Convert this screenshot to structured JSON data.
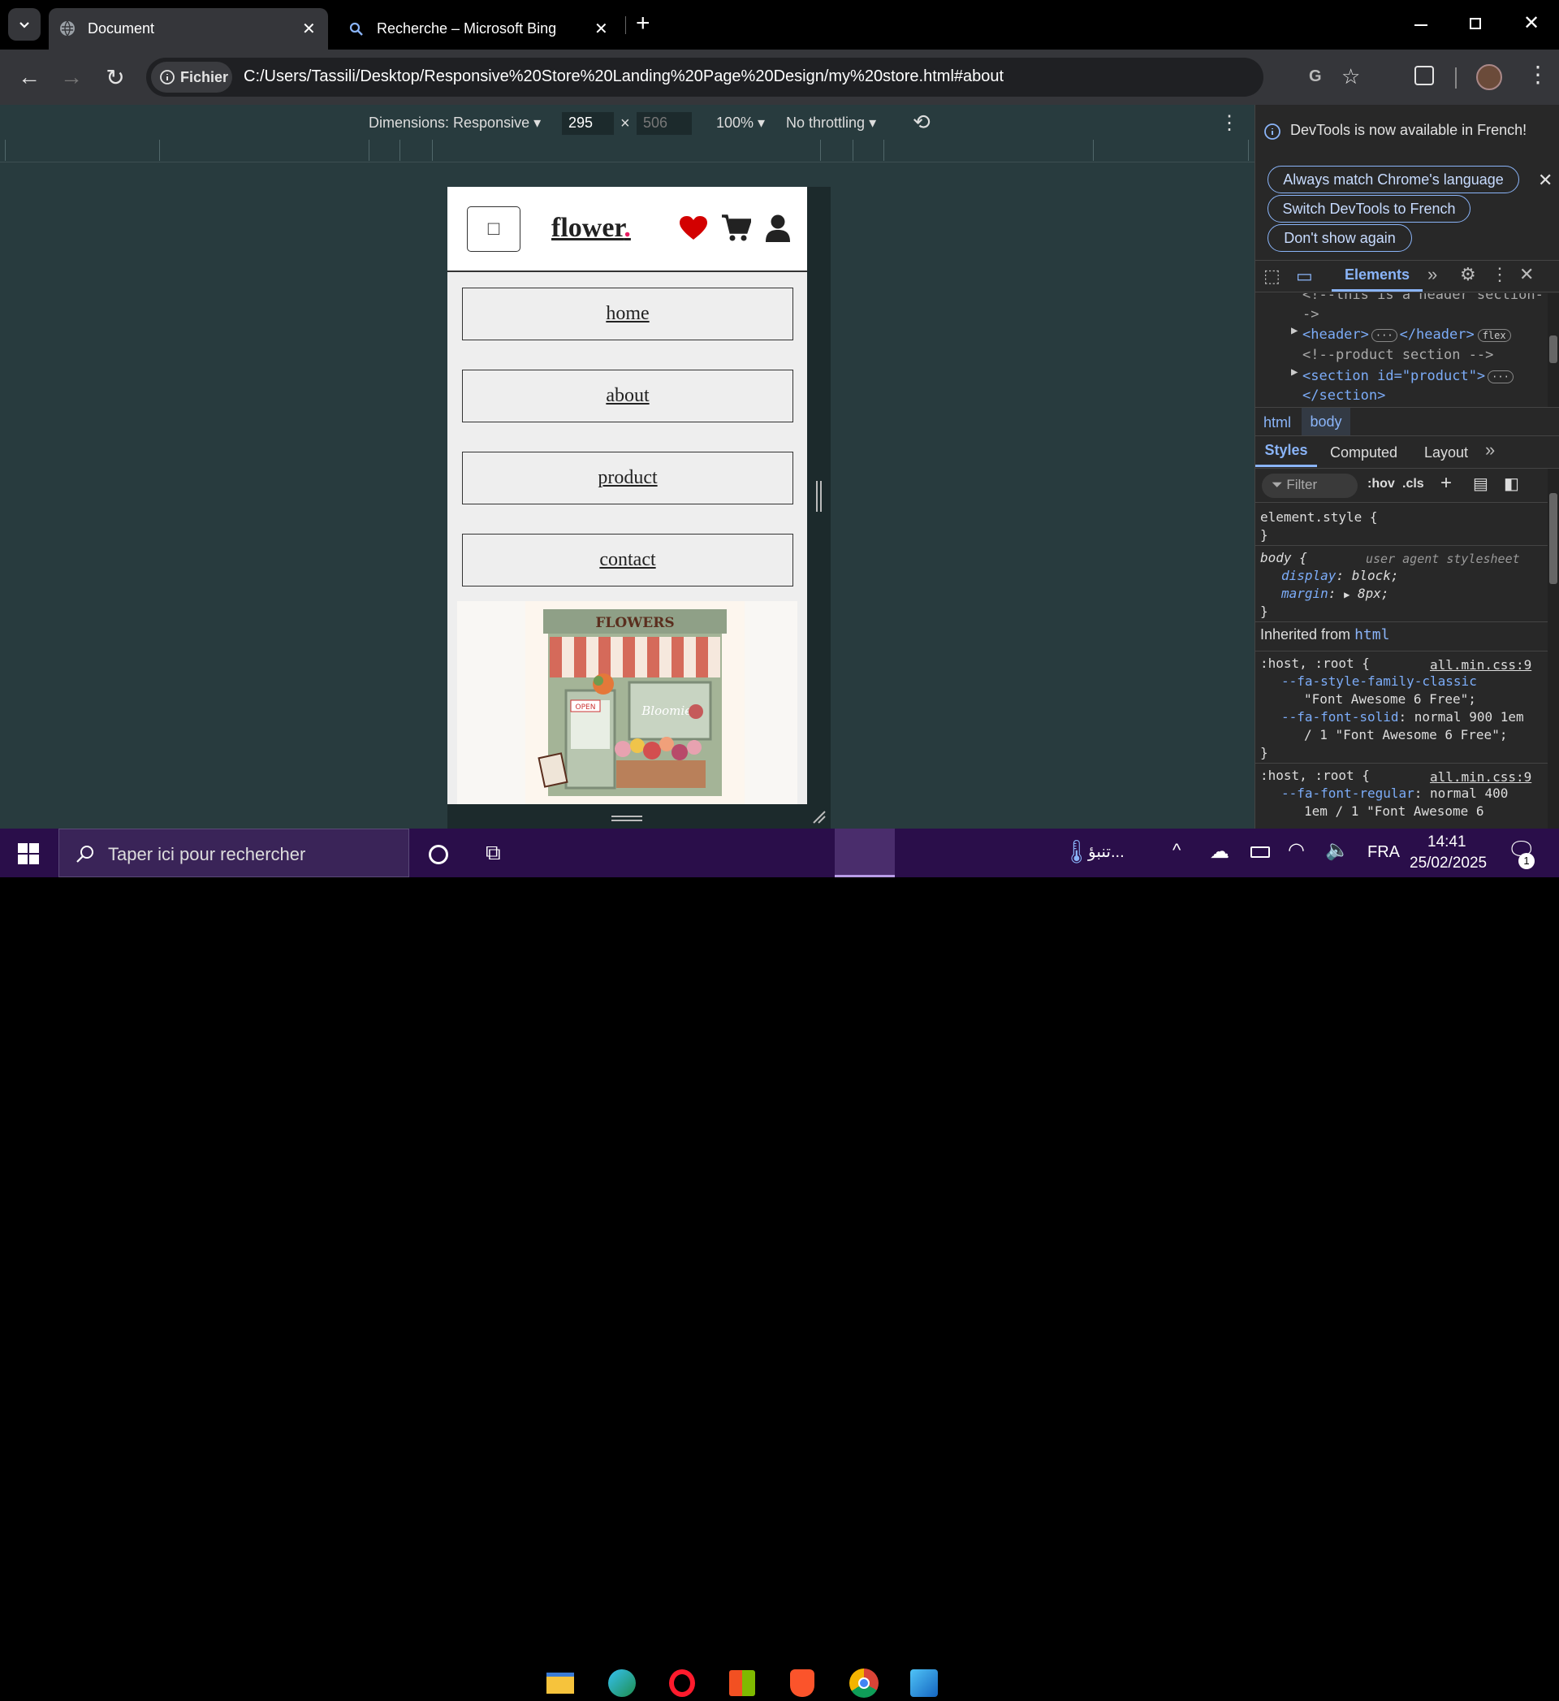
{
  "browser": {
    "tabs": [
      {
        "title": "Document",
        "active": true
      },
      {
        "title": "Recherche – Microsoft Bing",
        "active": false
      }
    ],
    "new_tab_label": "+",
    "site_info_label": "Fichier",
    "url": "C:/Users/Tassili/Desktop/Responsive%20Store%20Landing%20Page%20Design/my%20store.html#about"
  },
  "device_toolbar": {
    "dimensions_label": "Dimensions: Responsive",
    "width": "295",
    "height_placeholder": "506",
    "times": "×",
    "zoom": "100%",
    "throttling": "No throttling"
  },
  "page": {
    "logo": "flower",
    "logo_dot": ".",
    "menu_icon_glyph": "□",
    "nav": [
      "home",
      "about",
      "product",
      "contact"
    ],
    "shop_sign": "FLOWERS",
    "shop_name": "Bloomies",
    "open_sign": "OPEN",
    "colors": {
      "heart": "#d30000",
      "logo_dot": "#e91e63"
    }
  },
  "devtools": {
    "banner_text": "DevTools is now available in French!",
    "banner_buttons": [
      "Always match Chrome's language",
      "Switch DevTools to French",
      "Don't show again"
    ],
    "panel_tab": "Elements",
    "dom_lines": [
      "<!--this is a header section-",
      "->",
      "<header>",
      "</header>",
      "flex",
      "<!--product section -->",
      "<section id=\"product\">",
      "</section>"
    ],
    "breadcrumbs": [
      "html",
      "body"
    ],
    "subtabs": [
      "Styles",
      "Computed",
      "Layout"
    ],
    "filter_placeholder": "Filter",
    "hov": ":hov",
    "cls": ".cls",
    "styles": {
      "element_style": "element.style {",
      "close_brace": "}",
      "body_selector": "body {",
      "ua_label": "user agent stylesheet",
      "display_prop": "display",
      "display_val": "block;",
      "margin_prop": "margin",
      "margin_val": "8px;",
      "inherited_label": "Inherited from",
      "inherited_link": "html",
      "host_selector": ":host, :root {",
      "source": "all.min.css:9",
      "prop1": "--fa-style-family-classic",
      "val1": "\"Font Awesome 6 Free\";",
      "prop2": "--fa-font-solid",
      "val2a": "normal 900 1em",
      "val2b": "/ 1 \"Font Awesome 6 Free\";",
      "prop3": "--fa-font-regular",
      "val3a": "normal 400",
      "val3b": "1em / 1 \"Font Awesome 6"
    }
  },
  "taskbar": {
    "search_placeholder": "Taper ici pour rechercher",
    "weather": "تنبؤ...",
    "lang": "FRA",
    "time": "14:41",
    "date": "25/02/2025",
    "notif_count": "1"
  }
}
